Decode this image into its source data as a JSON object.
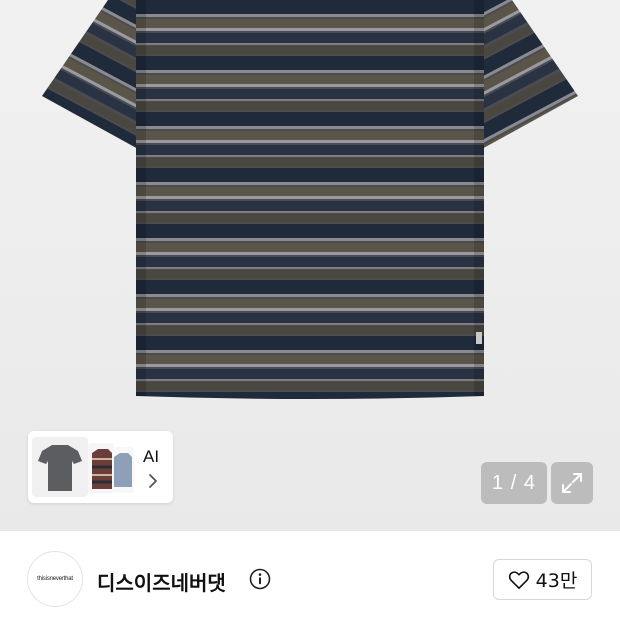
{
  "gallery": {
    "counter": "1 / 4",
    "expand_icon": "expand-arrows-icon",
    "product_colors": {
      "navy": "#1f2a3a",
      "charcoal": "#555555",
      "olive": "#4e4a40",
      "grey": "#7d7e82"
    }
  },
  "ai_card": {
    "label": "AI",
    "chevron_icon": "chevron-right-icon"
  },
  "seller": {
    "logo_text": "thisisneverthat",
    "name": "디스이즈네버댓",
    "info_icon": "info-circle-icon"
  },
  "like": {
    "icon": "heart-outline-icon",
    "count": "43만"
  }
}
